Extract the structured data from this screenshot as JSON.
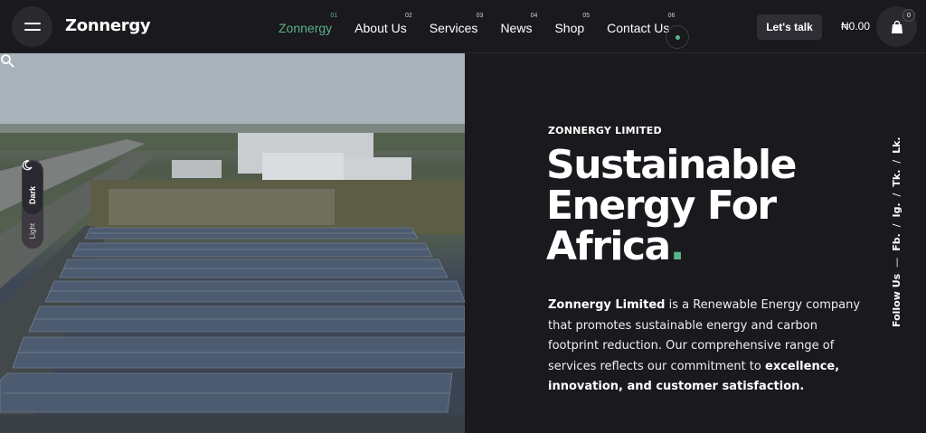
{
  "header": {
    "logo": "Zonnergy",
    "nav": [
      {
        "num": "01",
        "label": "Zonnergy",
        "active": true
      },
      {
        "num": "02",
        "label": "About Us"
      },
      {
        "num": "03",
        "label": "Services"
      },
      {
        "num": "04",
        "label": "News"
      },
      {
        "num": "05",
        "label": "Shop"
      },
      {
        "num": "06",
        "label": "Contact Us"
      }
    ],
    "cta": "Let's talk",
    "price": "₦0.00",
    "cart_count": "0"
  },
  "theme_toggle": {
    "dark": "Dark",
    "light": "Light"
  },
  "hero": {
    "eyebrow": "ZONNERGY LIMITED",
    "title_l1": "Sustainable",
    "title_l2": "Energy For",
    "title_l3": "Africa",
    "title_dot": ".",
    "desc_company": "Zonnergy Limited",
    "desc_mid": " is a Renewable Energy company that promotes sustainable energy and carbon footprint reduction. Our comprehensive range of services reflects our commitment to ",
    "desc_bold": "excellence, innovation, and customer satisfaction.",
    "accent_color": "#5ab487"
  },
  "social": {
    "label": "Follow Us",
    "dash": "—",
    "links": [
      "Fb.",
      "Ig.",
      "Tk.",
      "Lk."
    ],
    "sep": "/"
  }
}
